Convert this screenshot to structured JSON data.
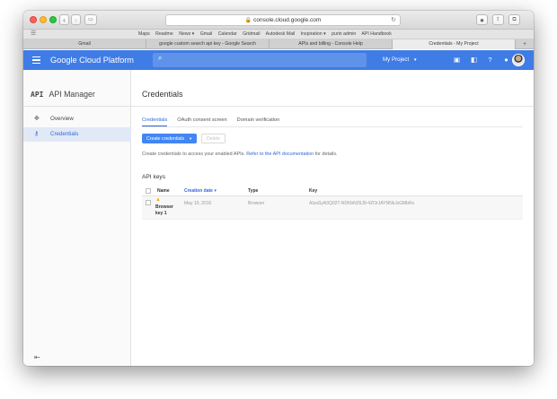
{
  "browser": {
    "url": "console.cloud.google.com",
    "bookmarks": [
      "Maps",
      "Readme",
      "News ▾",
      "Gmail",
      "Calendar",
      "Gridmail",
      "Autodesk Mail",
      "Inspiration ▾",
      "purin admin",
      "API Handbook"
    ],
    "tabs": [
      {
        "label": "Gmail",
        "active": false
      },
      {
        "label": "google custom search api key - Google Search",
        "active": false
      },
      {
        "label": "APIs and billing - Console Help",
        "active": false
      },
      {
        "label": "Credentials - My Project",
        "active": true
      }
    ]
  },
  "header": {
    "brand": "Google Cloud Platform",
    "project": "My Project",
    "color": "#3f7ce6"
  },
  "sidebar": {
    "api_badge": "API",
    "title": "API Manager",
    "items": [
      {
        "label": "Overview",
        "icon": "overview-icon",
        "active": false
      },
      {
        "label": "Credentials",
        "icon": "key-icon",
        "active": true
      }
    ]
  },
  "main": {
    "title": "Credentials",
    "subtabs": [
      "Credentials",
      "OAuth consent screen",
      "Domain verification"
    ],
    "create_button": "Create credentials",
    "delete_button": "Delete",
    "description_prefix": "Create credentials to access your enabled APIs. ",
    "description_link": "Refer to the API documentation",
    "description_suffix": " for details.",
    "section_title": "API keys",
    "columns": {
      "name": "Name",
      "date": "Creation date",
      "type": "Type",
      "key": "Key"
    },
    "rows": [
      {
        "name_line1": "Browser",
        "name_line2": "key 1",
        "date": "May 10, 2016",
        "type": "Browser",
        "key": "AIzaSyA3Q02T-NDKbN35J9-4ZOrJAYNNkJxGMbRs"
      }
    ]
  }
}
